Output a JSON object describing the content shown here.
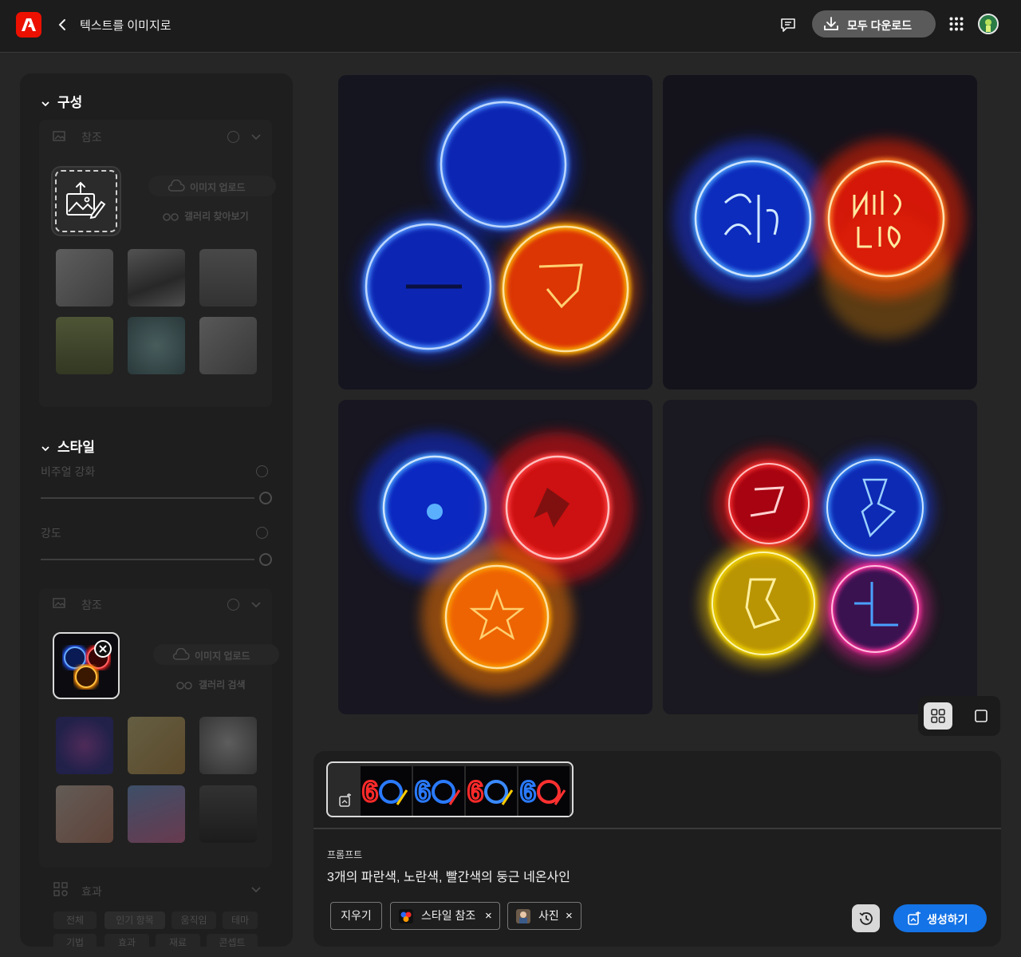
{
  "header": {
    "app_title": "텍스트를 이미지로",
    "download_all_label": "모두 다운로드",
    "icons": [
      "adobe-logo",
      "back-chevron-icon",
      "feedback-icon",
      "download-icon",
      "apps-grid-icon",
      "avatar"
    ]
  },
  "sidebar": {
    "composition": {
      "title": "구성",
      "reference": {
        "title": "참조",
        "upload_label": "이미지 업로드",
        "browse_label": "갤러리 찾아보기"
      }
    },
    "style": {
      "title": "스타일",
      "visual_intensity_label": "비주얼 강화",
      "strength_label": "강도",
      "reference": {
        "title": "참조",
        "upload_label": "이미지 업로드",
        "search_label": "갤러리 검색"
      }
    },
    "effects": {
      "title": "효과",
      "tabs": [
        "전체",
        "인기 항목",
        "움직임",
        "테마"
      ],
      "tabs_row2": [
        "기법",
        "효과",
        "재료",
        "콘셉트"
      ]
    }
  },
  "prompt": {
    "label": "프롬프트",
    "text": "3개의 파란색, 노란색, 빨간색의 둥근 네온사인",
    "clear_label": "지우기",
    "chip_style": "스타일 참조",
    "chip_photo": "사진",
    "generate_label": "생성하기"
  },
  "colors": {
    "accent": "#1473e6",
    "brand": "#eb1000",
    "panel": "#1e1e1e",
    "background": "#262626"
  }
}
